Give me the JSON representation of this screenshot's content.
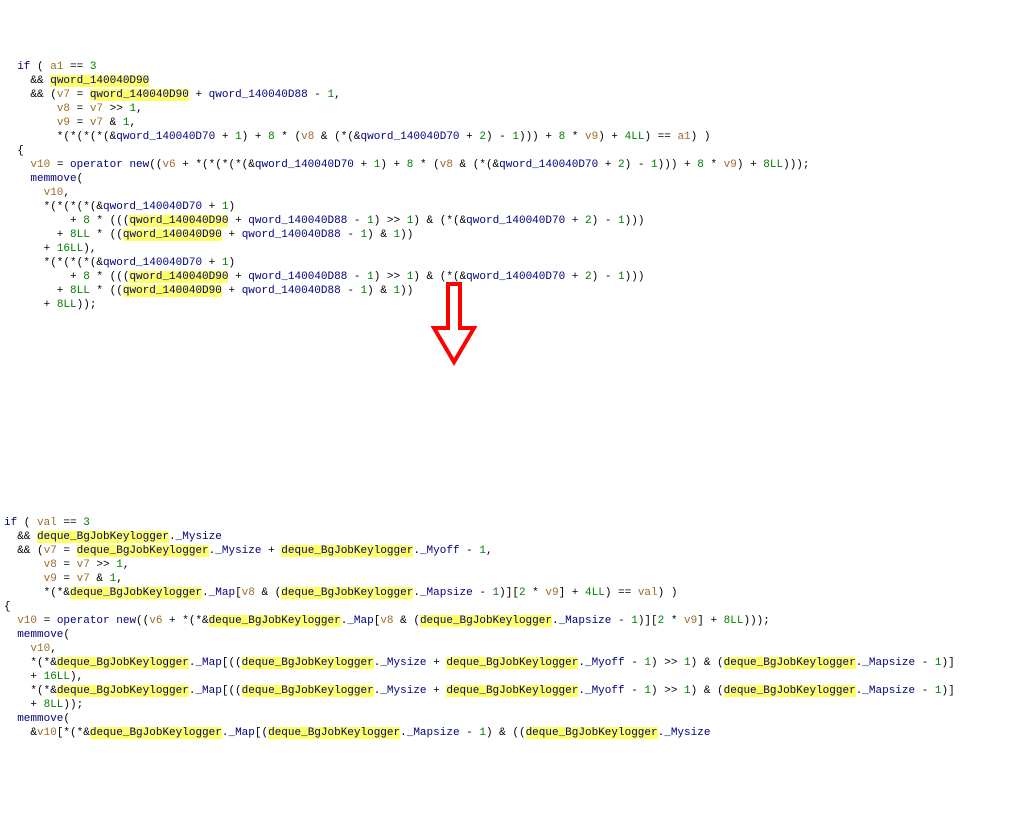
{
  "top": {
    "lines": [
      "  if ( a1 == 3",
      "    && qword_140040D90",
      "    && (v7 = qword_140040D90 + qword_140040D88 - 1,",
      "        v8 = v7 >> 1,",
      "        v9 = v7 & 1,",
      "        *(*(*(*(&qword_140040D70 + 1) + 8 * (v8 & (*(&qword_140040D70 + 2) - 1))) + 8 * v9) + 4LL) == a1) )",
      "  {",
      "    v10 = operator new((v6 + *(*(*(*(&qword_140040D70 + 1) + 8 * (v8 & (*(&qword_140040D70 + 2) - 1))) + 8 * v9) + 8LL)));",
      "    memmove(",
      "      v10,",
      "      *(*(*(*(&qword_140040D70 + 1)",
      "          + 8 * (((qword_140040D90 + qword_140040D88 - 1) >> 1) & (*(&qword_140040D70 + 2) - 1)))",
      "        + 8LL * ((qword_140040D90 + qword_140040D88 - 1) & 1))",
      "      + 16LL),",
      "      *(*(*(*(&qword_140040D70 + 1)",
      "          + 8 * (((qword_140040D90 + qword_140040D88 - 1) >> 1) & (*(&qword_140040D70 + 2) - 1)))",
      "        + 8LL * ((qword_140040D90 + qword_140040D88 - 1) & 1))",
      "      + 8LL));"
    ]
  },
  "bottom": {
    "lines": [
      "if ( val == 3",
      "  && deque_BgJobKeylogger._Mysize",
      "  && (v7 = deque_BgJobKeylogger._Mysize + deque_BgJobKeylogger._Myoff - 1,",
      "      v8 = v7 >> 1,",
      "      v9 = v7 & 1,",
      "      *(*&deque_BgJobKeylogger._Map[v8 & (deque_BgJobKeylogger._Mapsize - 1)][2 * v9] + 4LL) == val) )",
      "{",
      "  v10 = operator new((v6 + *(*&deque_BgJobKeylogger._Map[v8 & (deque_BgJobKeylogger._Mapsize - 1)][2 * v9] + 8LL)));",
      "  memmove(",
      "    v10,",
      "    *(*&deque_BgJobKeylogger._Map[((deque_BgJobKeylogger._Mysize + deque_BgJobKeylogger._Myoff - 1) >> 1) & (deque_BgJobKeylogger._Mapsize - 1)]",
      "    + 16LL),",
      "    *(*&deque_BgJobKeylogger._Map[((deque_BgJobKeylogger._Mysize + deque_BgJobKeylogger._Myoff - 1) >> 1) & (deque_BgJobKeylogger._Mapsize - 1)]",
      "    + 8LL));",
      "  memmove(",
      "    &v10[*(*&deque_BgJobKeylogger._Map[(deque_BgJobKeylogger._Mapsize - 1) & ((deque_BgJobKeylogger._Mysize"
    ]
  },
  "hl_top": "qword_140040D90",
  "hl_bot": "deque_BgJobKeylogger"
}
